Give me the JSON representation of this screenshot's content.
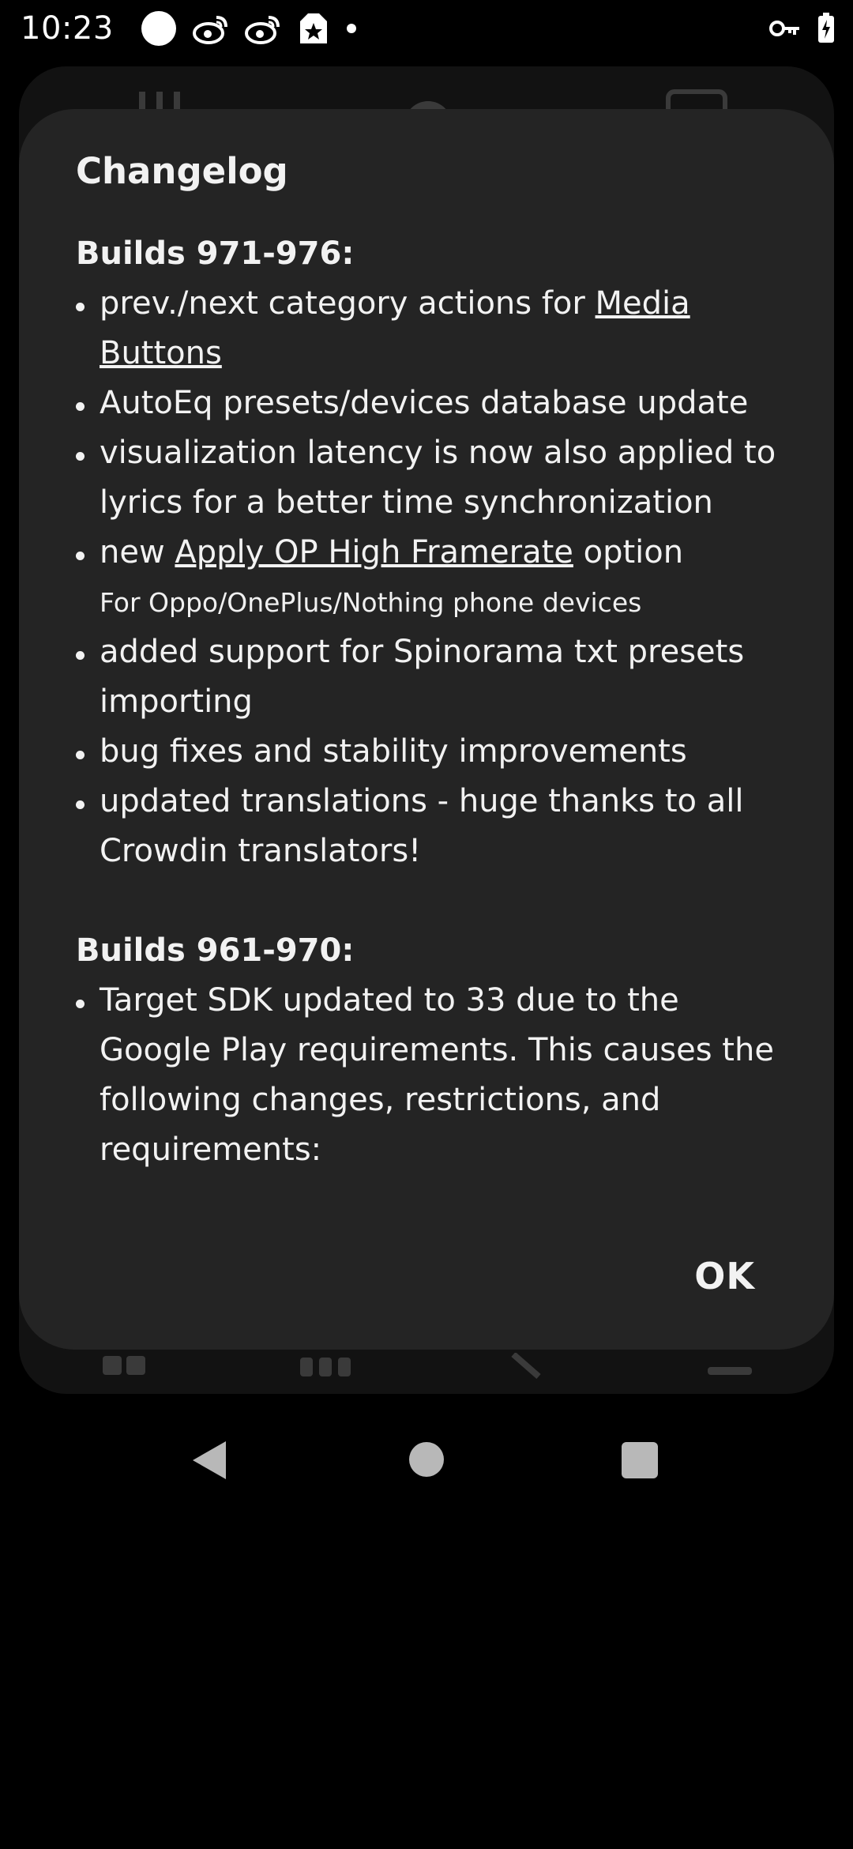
{
  "status_bar": {
    "time": "10:23",
    "icons_left": [
      "circle-notification-icon",
      "weibo-icon",
      "weibo-icon",
      "star-tag-icon",
      "dot-icon"
    ],
    "icons_right": [
      "vpn-key-icon",
      "battery-charging-icon"
    ]
  },
  "dialog": {
    "title": "Changelog",
    "sections": [
      {
        "heading": "Builds 971-976:",
        "items": [
          {
            "pre": "prev./next category actions for ",
            "link": "Media Buttons",
            "post": ""
          },
          {
            "pre": "AutoEq presets/devices database update",
            "link": "",
            "post": ""
          },
          {
            "pre": "visualization latency is now also applied to lyrics for a better time synchronization",
            "link": "",
            "post": ""
          },
          {
            "pre": "new ",
            "link": "Apply OP High Framerate",
            "post": " option",
            "note": "For Oppo/OnePlus/Nothing phone devices"
          },
          {
            "pre": "added support for Spinorama txt presets importing",
            "link": "",
            "post": ""
          },
          {
            "pre": "bug fixes and stability improvements",
            "link": "",
            "post": ""
          },
          {
            "pre": "updated translations - huge thanks to all Crowdin translators!",
            "link": "",
            "post": ""
          }
        ]
      },
      {
        "heading": "Builds 961-970:",
        "items": [
          {
            "pre": "Target SDK updated to 33 due to the Google Play requirements. This causes the following changes, restrictions, and requirements:",
            "link": "",
            "post": ""
          }
        ]
      }
    ],
    "ok_label": "OK"
  },
  "nav": {
    "back": "back-icon",
    "home": "home-icon",
    "recents": "recents-icon"
  }
}
